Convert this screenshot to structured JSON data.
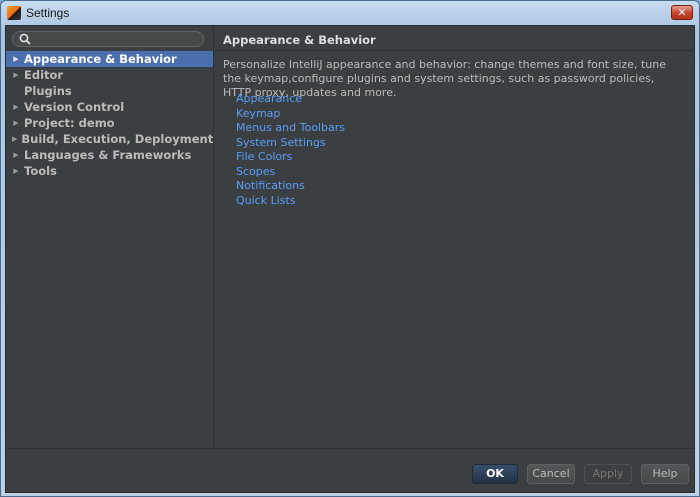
{
  "window": {
    "title": "Settings",
    "close_glyph": "✕",
    "app_icon": "intellij-app-icon"
  },
  "search": {
    "value": "",
    "placeholder": "",
    "icon": "search-icon"
  },
  "sidebar": {
    "items": [
      {
        "label": "Appearance & Behavior",
        "expandable": true,
        "selected": true,
        "arrow": "▶"
      },
      {
        "label": "Editor",
        "expandable": true,
        "selected": false,
        "arrow": "▶"
      },
      {
        "label": "Plugins",
        "expandable": false,
        "selected": false,
        "arrow": "▶"
      },
      {
        "label": "Version Control",
        "expandable": true,
        "selected": false,
        "arrow": "▶"
      },
      {
        "label": "Project: demo",
        "expandable": true,
        "selected": false,
        "arrow": "▶"
      },
      {
        "label": "Build, Execution, Deployment",
        "expandable": true,
        "selected": false,
        "arrow": "▶"
      },
      {
        "label": "Languages & Frameworks",
        "expandable": true,
        "selected": false,
        "arrow": "▶"
      },
      {
        "label": "Tools",
        "expandable": true,
        "selected": false,
        "arrow": "▶"
      }
    ]
  },
  "content": {
    "title": "Appearance & Behavior",
    "description": "Personalize IntelliJ appearance and behavior: change themes and font size, tune the keymap,configure plugins and system settings, such as password policies, HTTP proxy, updates and more.",
    "links": [
      "Appearance",
      "Keymap",
      "Menus and Toolbars",
      "System Settings",
      "File Colors",
      "Scopes",
      "Notifications",
      "Quick Lists"
    ]
  },
  "buttons": {
    "ok": "OK",
    "cancel": "Cancel",
    "apply": "Apply",
    "help": "Help"
  },
  "colors": {
    "background": "#3c3f41",
    "selection": "#4b6eaf",
    "link": "#589df6"
  }
}
